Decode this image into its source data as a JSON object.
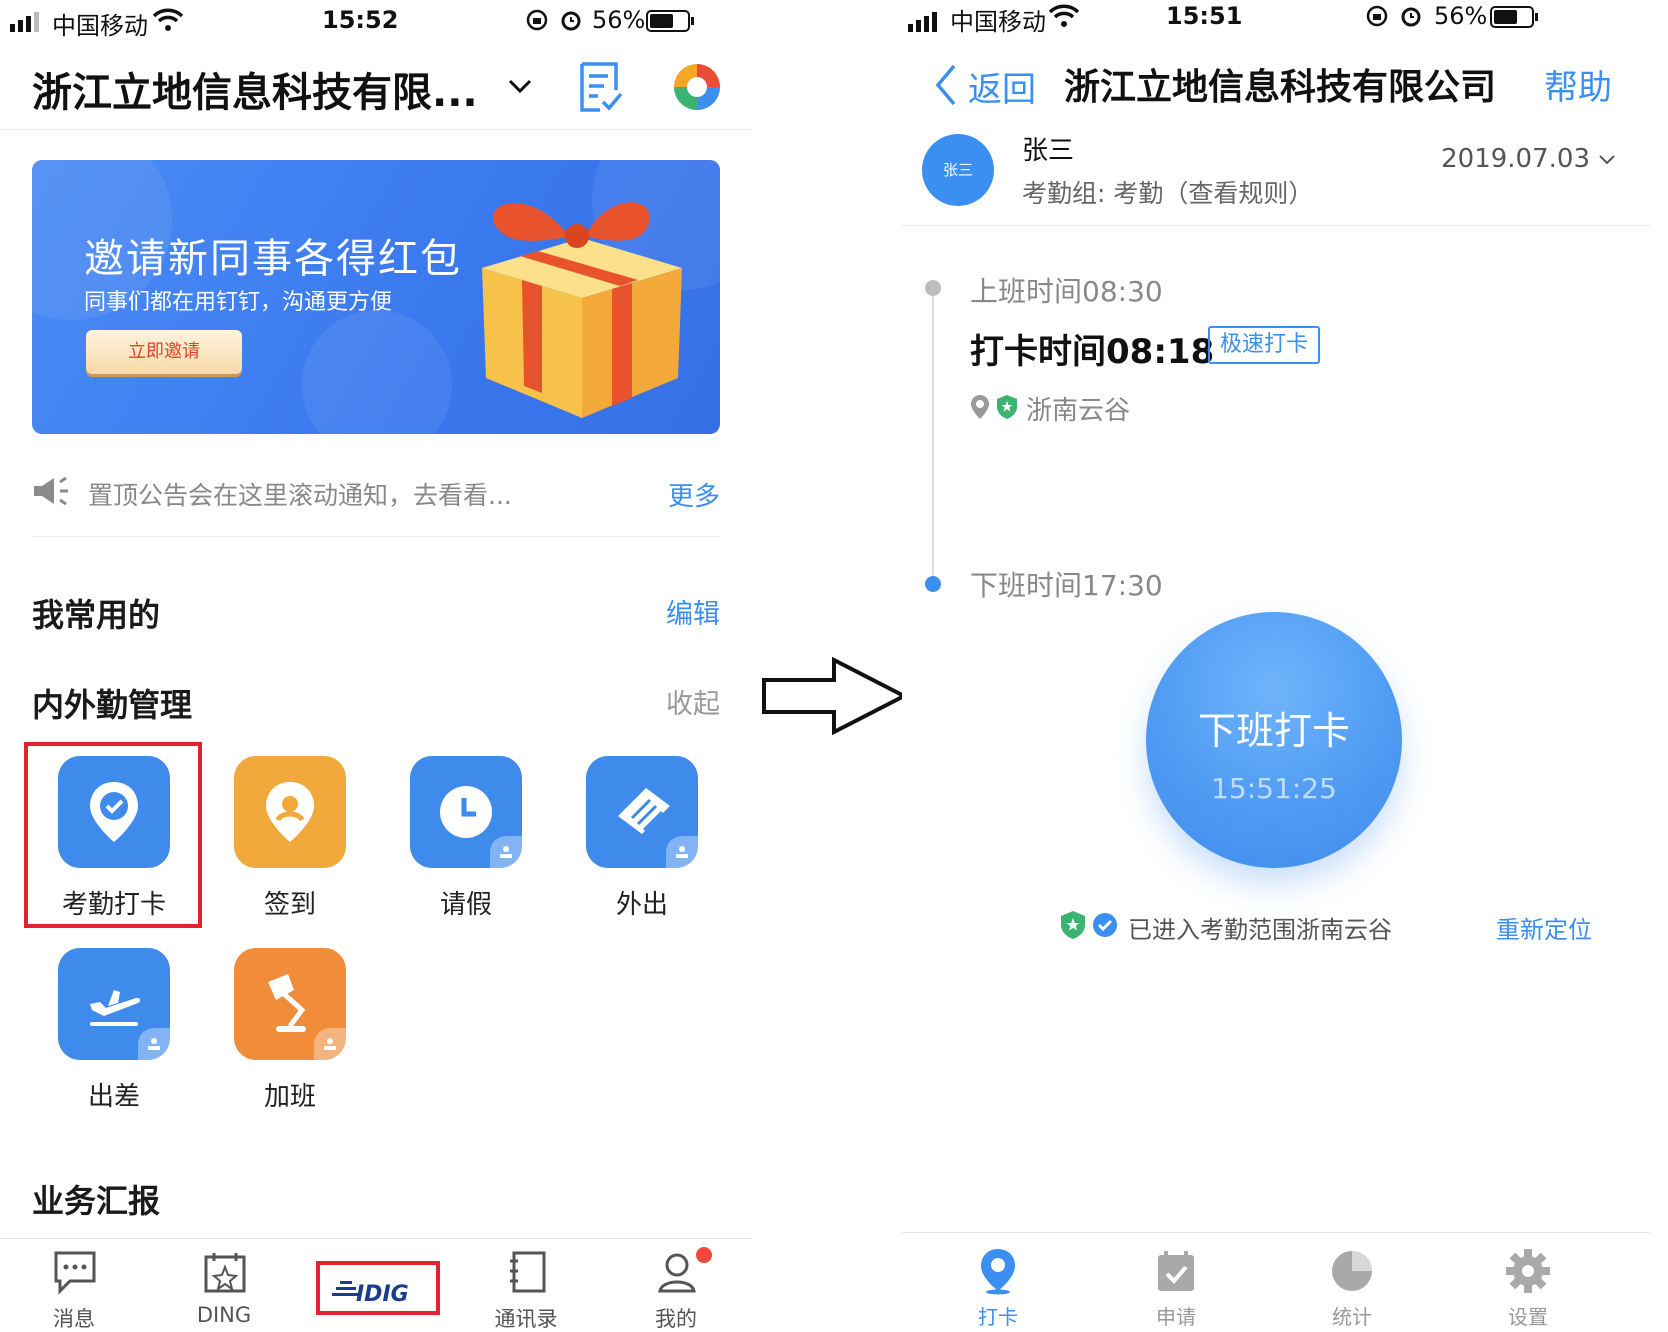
{
  "left_phone": {
    "status_bar": {
      "carrier": "中国移动",
      "time": "15:52",
      "battery": "56%"
    },
    "header": {
      "org_name": "浙江立地信息科技有限..."
    },
    "banner": {
      "title": "邀请新同事各得红包",
      "subtitle": "同事们都在用钉钉，沟通更方便",
      "button": "立即邀请"
    },
    "notice": {
      "text": "置顶公告会在这里滚动通知，去看看...",
      "more": "更多"
    },
    "favorites": {
      "title": "我常用的",
      "action": "编辑"
    },
    "attendance_section": {
      "title": "内外勤管理",
      "action": "收起",
      "apps": [
        {
          "label": "考勤打卡",
          "icon": "attendance-pin-icon",
          "color": "#3f8bec"
        },
        {
          "label": "签到",
          "icon": "checkin-pin-icon",
          "color": "#f2a93b"
        },
        {
          "label": "请假",
          "icon": "clock-icon",
          "color": "#3f8bec"
        },
        {
          "label": "外出",
          "icon": "outing-icon",
          "color": "#3f8bec"
        },
        {
          "label": "出差",
          "icon": "plane-icon",
          "color": "#3f8bec"
        },
        {
          "label": "加班",
          "icon": "lamp-icon",
          "color": "#f08c3a"
        }
      ]
    },
    "report_section": {
      "title": "业务汇报"
    },
    "tabs": [
      {
        "label": "消息",
        "icon": "chat-icon"
      },
      {
        "label": "DING",
        "icon": "ding-icon"
      },
      {
        "label": "LIDIG",
        "icon": "brand-logo"
      },
      {
        "label": "通讯录",
        "icon": "contacts-icon"
      },
      {
        "label": "我的",
        "icon": "profile-icon"
      }
    ]
  },
  "right_phone": {
    "status_bar": {
      "carrier": "中国移动",
      "time": "15:51",
      "battery": "56%"
    },
    "nav": {
      "back": "返回",
      "title": "浙江立地信息科技有限公司",
      "help": "帮助"
    },
    "user": {
      "avatar_text": "张三",
      "name": "张三",
      "group": "考勤组: 考勤（查看规则）",
      "date": "2019.07.03"
    },
    "schedule": {
      "start_label": "上班时间08:30",
      "punch_time": "打卡时间08:18",
      "speed_badge": "极速打卡",
      "location": "浙南云谷",
      "end_label": "下班时间17:30"
    },
    "clock_button": {
      "label": "下班打卡",
      "time": "15:51:25"
    },
    "range": {
      "text": "已进入考勤范围浙南云谷",
      "relocate": "重新定位"
    },
    "tabs": [
      {
        "label": "打卡",
        "icon": "location-pin-icon",
        "active": true
      },
      {
        "label": "申请",
        "icon": "calendar-check-icon",
        "active": false
      },
      {
        "label": "统计",
        "icon": "pie-chart-icon",
        "active": false
      },
      {
        "label": "设置",
        "icon": "gear-icon",
        "active": false
      }
    ]
  },
  "colors": {
    "accent": "#3a8ff0",
    "highlight": "#e0232f",
    "orange": "#f2a93b"
  }
}
